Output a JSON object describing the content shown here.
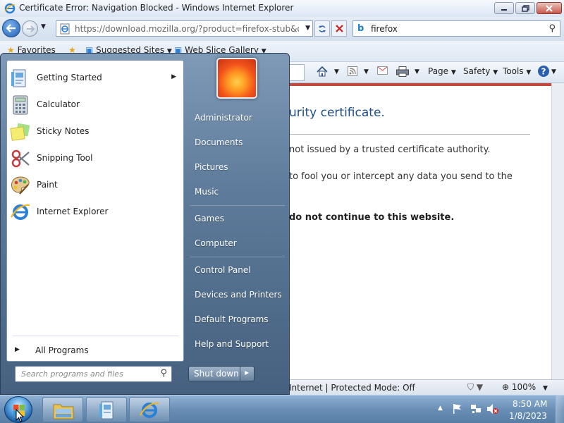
{
  "window": {
    "title": "Certificate Error: Navigation Blocked - Windows Internet Explorer"
  },
  "address_bar": {
    "url": "https://download.mozilla.org/?product=firefox-stub&os=wi"
  },
  "search_box": {
    "value": "firefox"
  },
  "favorites_bar": {
    "favorites_label": "Favorites",
    "suggested_sites": "Suggested Sites",
    "web_slice_gallery": "Web Slice Gallery"
  },
  "command_bar": {
    "page": "Page",
    "safety": "Safety",
    "tools": "Tools"
  },
  "error_page": {
    "heading_fragment": "urity certificate.",
    "line1": "not issued by a trusted certificate authority.",
    "line2": "to fool you or intercept any data you send to the",
    "line3": "do not continue to this website."
  },
  "status_bar": {
    "zone": "Internet | Protected Mode: Off",
    "zoom": "100%"
  },
  "start_menu": {
    "programs": [
      {
        "label": "Getting Started",
        "has_submenu": true
      },
      {
        "label": "Calculator"
      },
      {
        "label": "Sticky Notes"
      },
      {
        "label": "Snipping Tool"
      },
      {
        "label": "Paint"
      },
      {
        "label": "Internet Explorer"
      }
    ],
    "all_programs": "All Programs",
    "search_placeholder": "Search programs and files",
    "right_items": [
      "Administrator",
      "Documents",
      "Pictures",
      "Music",
      "Games",
      "Computer",
      "Control Panel",
      "Devices and Printers",
      "Default Programs",
      "Help and Support"
    ],
    "shutdown": "Shut down"
  },
  "taskbar": {
    "time": "8:50 AM",
    "date": "1/8/2023"
  },
  "colors": {
    "accent_blue": "#1f5fb5",
    "error_border": "#c24a3d",
    "heading_blue": "#1f4e8c"
  }
}
